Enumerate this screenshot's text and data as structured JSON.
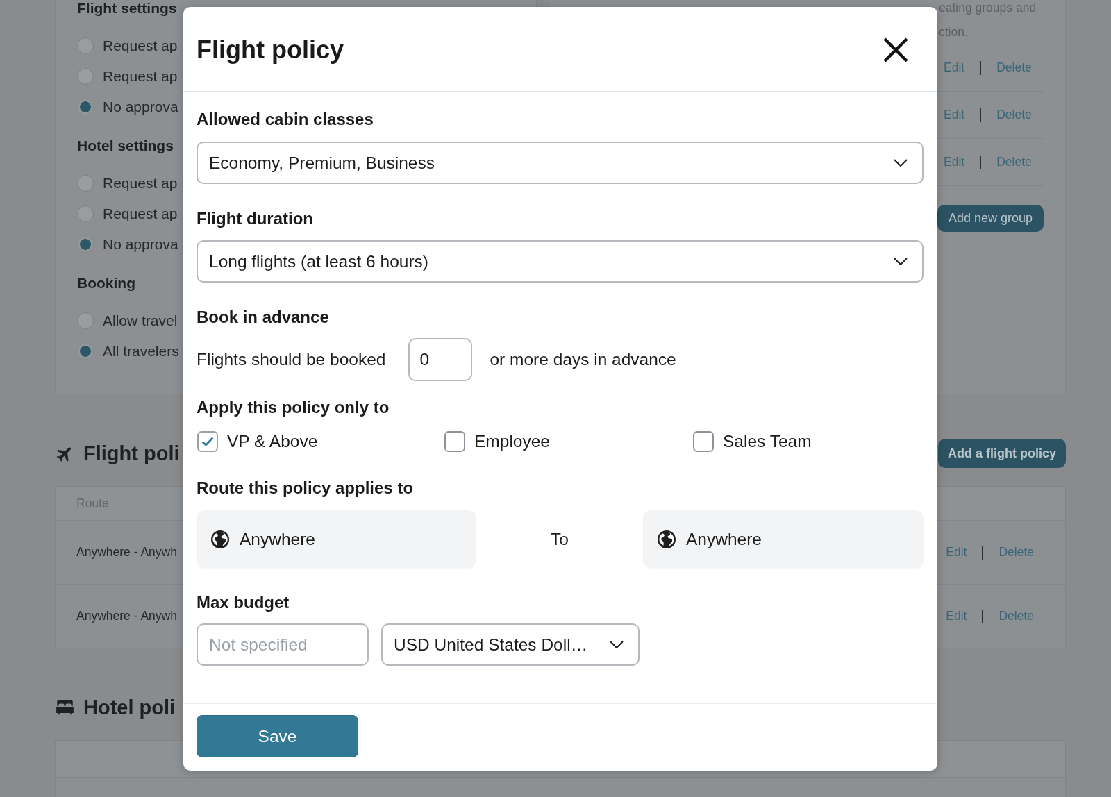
{
  "background": {
    "settings_panel": {
      "sections": [
        {
          "heading": "Flight settings",
          "options": [
            {
              "label": "Request ap",
              "selected": false
            },
            {
              "label": "Request ap",
              "selected": false
            },
            {
              "label": "No approva",
              "selected": true
            }
          ]
        },
        {
          "heading": "Hotel settings",
          "options": [
            {
              "label": "Request ap",
              "selected": false
            },
            {
              "label": "Request ap",
              "selected": false
            },
            {
              "label": "No approva",
              "selected": true
            }
          ]
        },
        {
          "heading": "Booking",
          "options": [
            {
              "label": "Allow travel",
              "selected": false
            },
            {
              "label": "All travelers",
              "selected": true
            }
          ]
        }
      ]
    },
    "groups_panel": {
      "description": [
        "eating groups and",
        "ction."
      ],
      "rows": [
        {
          "actions": [
            "Edit",
            "Delete"
          ]
        },
        {
          "actions": [
            "Edit",
            "Delete"
          ]
        },
        {
          "actions": [
            "Edit",
            "Delete"
          ]
        }
      ],
      "add_button": "Add new group"
    },
    "flight_policies": {
      "title": "Flight poli",
      "add_button": "Add a flight policy",
      "table": {
        "columns": [
          "Route"
        ],
        "rows": [
          {
            "route": "Anywhere - Anywh",
            "actions": [
              "Edit",
              "Delete"
            ]
          },
          {
            "route": "Anywhere - Anywh",
            "actions": [
              "Edit",
              "Delete"
            ]
          }
        ]
      }
    },
    "hotel_policies": {
      "title": "Hotel poli"
    }
  },
  "dialog": {
    "title": "Flight policy",
    "cabin_classes": {
      "label": "Allowed cabin classes",
      "value": "Economy, Premium, Business"
    },
    "flight_duration": {
      "label": "Flight duration",
      "value": "Long flights (at least 6 hours)"
    },
    "book_in_advance": {
      "label": "Book in advance",
      "text_before": "Flights should be booked",
      "value": "0",
      "text_after": "or more days in advance"
    },
    "apply_to": {
      "label": "Apply this policy only to",
      "options": [
        {
          "label": "VP & Above",
          "checked": true
        },
        {
          "label": "Employee",
          "checked": false
        },
        {
          "label": "Sales Team",
          "checked": false
        }
      ]
    },
    "route": {
      "label": "Route this policy applies to",
      "from": "Anywhere",
      "connector": "To",
      "to": "Anywhere"
    },
    "max_budget": {
      "label": "Max budget",
      "amount": {
        "placeholder": "Not specified"
      },
      "currency": {
        "value": "USD United States Doll…"
      }
    },
    "save_button": "Save"
  }
}
